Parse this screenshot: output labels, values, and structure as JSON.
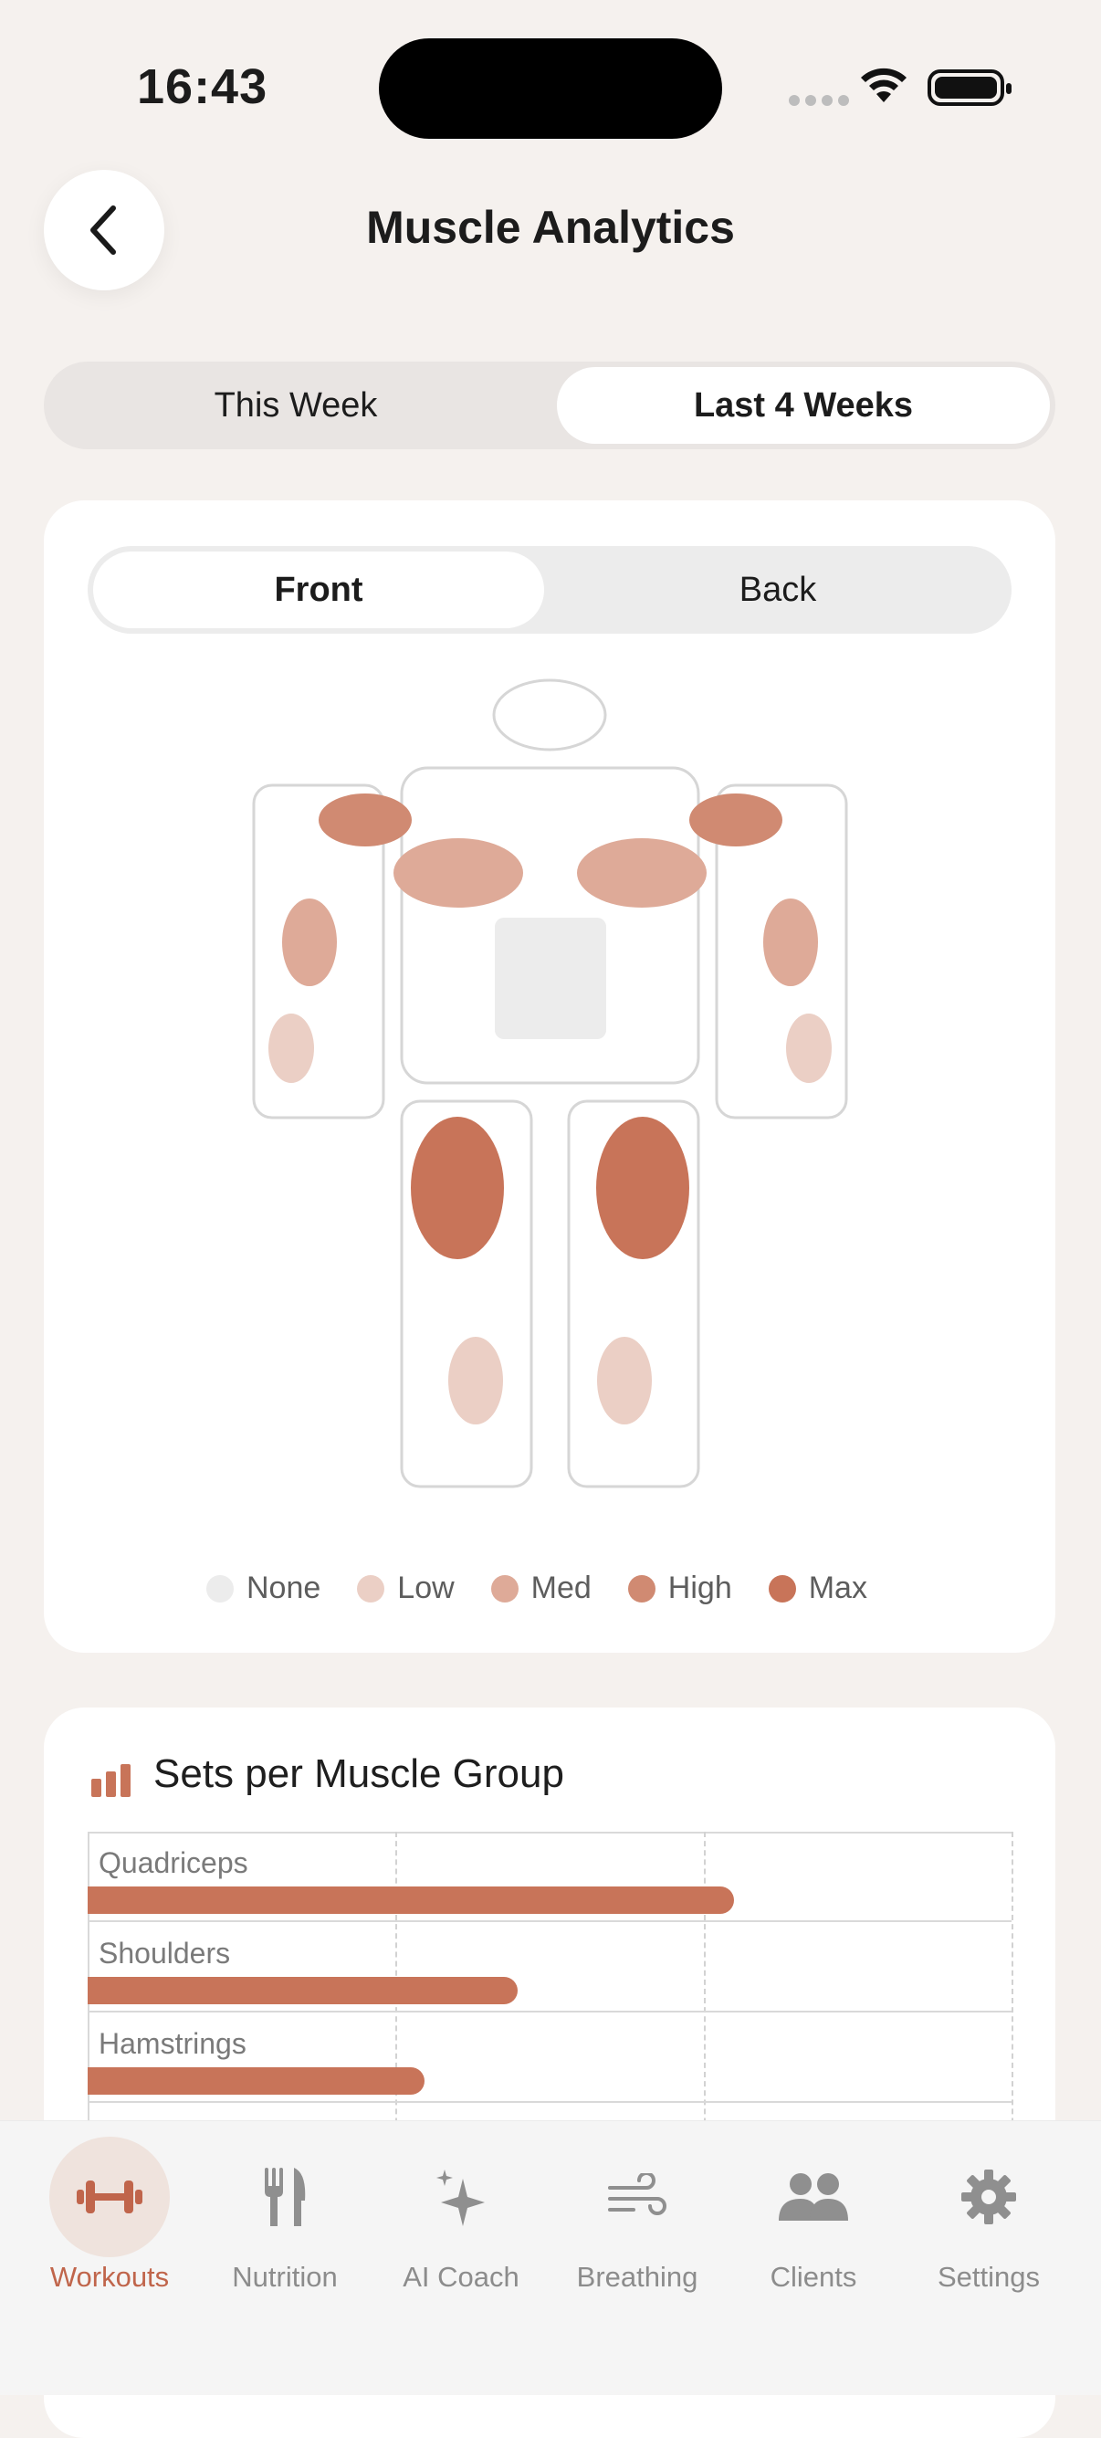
{
  "status_bar": {
    "time": "16:43"
  },
  "header": {
    "title": "Muscle Analytics",
    "back_icon": "chevron-left-icon"
  },
  "period_toggle": {
    "options": [
      "This Week",
      "Last 4 Weeks"
    ],
    "selected": "Last 4 Weeks"
  },
  "view_toggle": {
    "options": [
      "Front",
      "Back"
    ],
    "selected": "Front"
  },
  "intensity_colors": {
    "none": "#ececec",
    "low": "#ebcfc5",
    "med": "#deaa98",
    "high": "#d08a72",
    "max": "#c87459"
  },
  "body_map": {
    "regions": [
      {
        "name": "head",
        "intensity": "outline"
      },
      {
        "name": "left-shoulder",
        "intensity": "high"
      },
      {
        "name": "right-shoulder",
        "intensity": "high"
      },
      {
        "name": "left-chest",
        "intensity": "med"
      },
      {
        "name": "right-chest",
        "intensity": "med"
      },
      {
        "name": "abs",
        "intensity": "none"
      },
      {
        "name": "left-biceps",
        "intensity": "med"
      },
      {
        "name": "right-biceps",
        "intensity": "med"
      },
      {
        "name": "left-forearm",
        "intensity": "low"
      },
      {
        "name": "right-forearm",
        "intensity": "low"
      },
      {
        "name": "left-quad",
        "intensity": "max"
      },
      {
        "name": "right-quad",
        "intensity": "max"
      },
      {
        "name": "left-calf",
        "intensity": "low"
      },
      {
        "name": "right-calf",
        "intensity": "low"
      }
    ]
  },
  "legend": [
    {
      "label": "None",
      "color": "#ececec"
    },
    {
      "label": "Low",
      "color": "#ebcfc5"
    },
    {
      "label": "Med",
      "color": "#deaa98"
    },
    {
      "label": "High",
      "color": "#d08a72"
    },
    {
      "label": "Max",
      "color": "#c87459"
    }
  ],
  "sets_section": {
    "title": "Sets per Muscle Group",
    "icon": "bar-chart-icon"
  },
  "chart_data": {
    "type": "bar",
    "orientation": "horizontal",
    "categories": [
      "Quadriceps",
      "Shoulders",
      "Hamstrings"
    ],
    "values": [
      0.7,
      0.465,
      0.365
    ],
    "value_unit": "fraction of chart width",
    "grid": true
  },
  "tabs": [
    {
      "label": "Workouts",
      "icon": "dumbbell-icon",
      "active": true
    },
    {
      "label": "Nutrition",
      "icon": "fork-knife-icon",
      "active": false
    },
    {
      "label": "AI Coach",
      "icon": "sparkles-icon",
      "active": false
    },
    {
      "label": "Breathing",
      "icon": "wind-icon",
      "active": false
    },
    {
      "label": "Clients",
      "icon": "people-icon",
      "active": false
    },
    {
      "label": "Settings",
      "icon": "gear-icon",
      "active": false
    }
  ]
}
